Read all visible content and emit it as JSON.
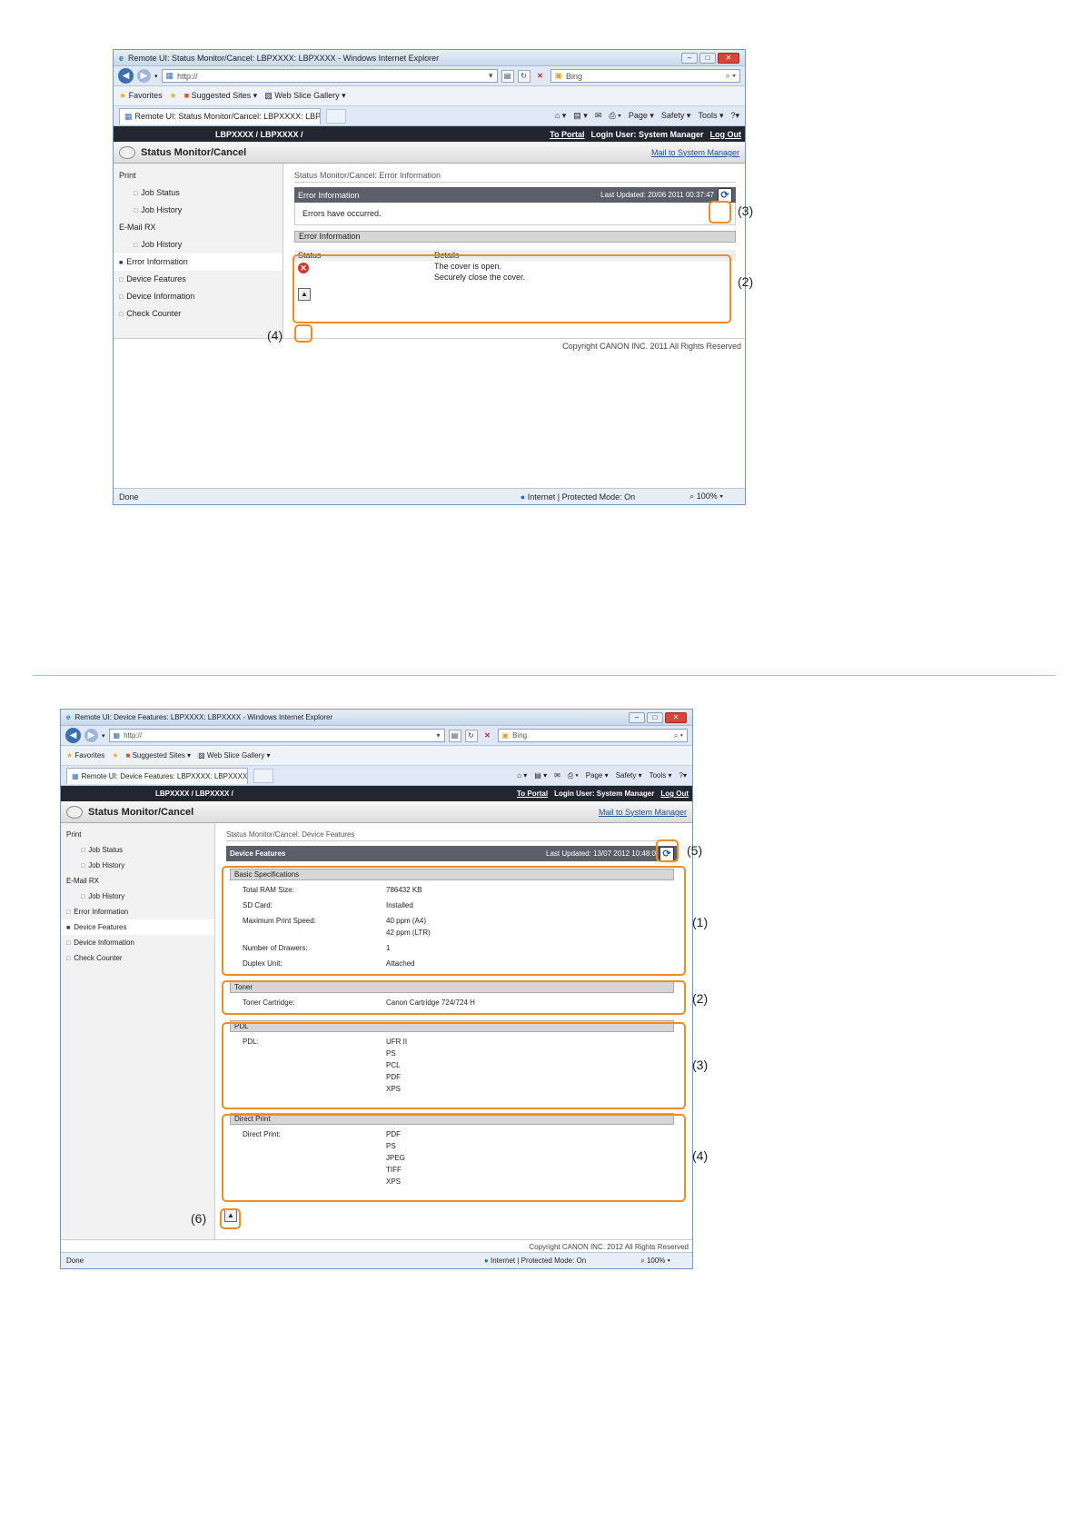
{
  "shot1": {
    "window_title": "Remote UI: Status Monitor/Cancel: LBPXXXX: LBPXXXX - Windows Internet Explorer",
    "address": "http://",
    "search": "Bing",
    "favorites": "Favorites",
    "suggested_sites": "Suggested Sites ▾",
    "web_slice": "Web Slice Gallery ▾",
    "tab_title": "Remote UI: Status Monitor/Cancel: LBPXXXX: LBP...",
    "cmd": {
      "page": "Page ▾",
      "safety": "Safety ▾",
      "tools": "Tools ▾",
      "help": "?▾"
    },
    "printer_name": "LBPXXXX / LBPXXXX /",
    "to_portal": "To Portal",
    "login_user": "Login User: System Manager",
    "log_out": "Log Out",
    "app_title": "Status Monitor/Cancel",
    "mail": "Mail to System Manager",
    "sidebar": {
      "print": "Print",
      "job_status": "Job Status",
      "job_history": "Job History",
      "email_rx": "E-Mail RX",
      "rx_job_history": "Job History",
      "error_information": "Error Information",
      "device_features": "Device Features",
      "device_information": "Device Information",
      "check_counter": "Check Counter"
    },
    "breadcrumb": "Status Monitor/Cancel: Error Information",
    "panel_title": "Error Information",
    "last_updated": "Last Updated: 20/06 2011 00:37:47",
    "message": "Errors have occurred.",
    "section_title": "Error Information",
    "col_status": "Status",
    "col_details": "Details",
    "detail_line1": "The cover is open.",
    "detail_line2": "Securely close the cover.",
    "copyright": "Copyright CANON INC. 2011 All Rights Reserved",
    "status_left": "Done",
    "status_mid": "Internet | Protected Mode: On",
    "zoom": "100%",
    "callouts": {
      "c2": "(2)",
      "c3": "(3)",
      "c4": "(4)"
    }
  },
  "shot2": {
    "window_title": "Remote UI: Device Features: LBPXXXX: LBPXXXX - Windows Internet Explorer",
    "address": "http://",
    "search": "Bing",
    "favorites": "Favorites",
    "suggested_sites": "Suggested Sites ▾",
    "web_slice": "Web Slice Gallery ▾",
    "tab_title": "Remote UI: Device Features: LBPXXXX: LBPXXXX",
    "cmd": {
      "page": "Page ▾",
      "safety": "Safety ▾",
      "tools": "Tools ▾",
      "help": "?▾"
    },
    "printer_name": "LBPXXXX / LBPXXXX /",
    "to_portal": "To Portal",
    "login_user": "Login User: System Manager",
    "log_out": "Log Out",
    "app_title": "Status Monitor/Cancel",
    "mail": "Mail to System Manager",
    "sidebar": {
      "print": "Print",
      "job_status": "Job Status",
      "job_history": "Job History",
      "email_rx": "E-Mail RX",
      "rx_job_history": "Job History",
      "error_information": "Error Information",
      "device_features": "Device Features",
      "device_information": "Device Information",
      "check_counter": "Check Counter"
    },
    "breadcrumb": "Status Monitor/Cancel: Device Features",
    "panel_title": "Device Features",
    "last_updated": "Last Updated: 13/07 2012 10:48:0",
    "basic": {
      "title": "Basic Specifications",
      "ram_label": "Total RAM Size:",
      "ram_value": "786432 KB",
      "sd_label": "SD Card:",
      "sd_value": "Installed",
      "speed_label": "Maximum Print Speed:",
      "speed_a4": "40 ppm (A4)",
      "speed_ltr": "42 ppm (LTR)",
      "drawers_label": "Number of Drawers:",
      "drawers_value": "1",
      "duplex_label": "Duplex Unit:",
      "duplex_value": "Attached"
    },
    "toner": {
      "title": "Toner",
      "label": "Toner Cartridge:",
      "value": "Canon Cartridge 724/724 H"
    },
    "pdl": {
      "title": "PDL",
      "label": "PDL:",
      "values": [
        "UFR II",
        "PS",
        "PCL",
        "PDF",
        "XPS"
      ]
    },
    "direct_print": {
      "title": "Direct Print",
      "label": "Direct Print:",
      "values": [
        "PDF",
        "PS",
        "JPEG",
        "TIFF",
        "XPS"
      ]
    },
    "copyright": "Copyright CANON INC. 2012 All Rights Reserved",
    "status_left": "Done",
    "status_mid": "Internet | Protected Mode: On",
    "zoom": "100%",
    "callouts": {
      "c1": "(1)",
      "c2": "(2)",
      "c3": "(3)",
      "c4": "(4)",
      "c5": "(5)",
      "c6": "(6)"
    }
  },
  "colors": {
    "highlight": "#f08c20",
    "dark_header": "#222630",
    "error_red": "#d9302a"
  }
}
